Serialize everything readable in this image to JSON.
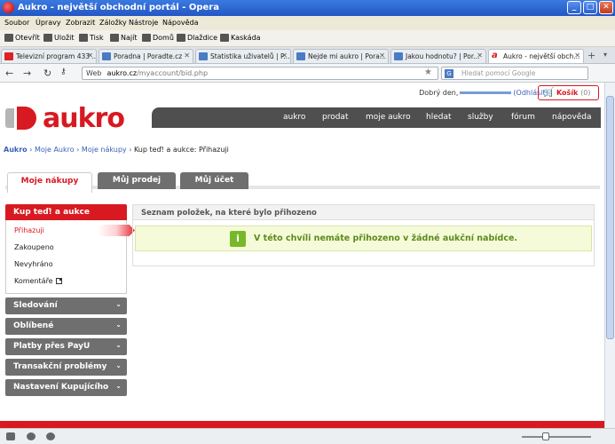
{
  "window": {
    "title": "Aukro - největší obchodní portál - Opera"
  },
  "menu": [
    "Soubor",
    "Úpravy",
    "Zobrazit",
    "Záložky",
    "Nástroje",
    "Nápověda"
  ],
  "toolbar": [
    "Otevřít",
    "Uložit",
    "Tisk",
    "Najít",
    "Domů",
    "Dlaždice",
    "Kaskáda"
  ],
  "tabs": [
    {
      "label": "Televizní program 433 ..."
    },
    {
      "label": "Poradna | Poradte.cz"
    },
    {
      "label": "Statistika uživatelů | P..."
    },
    {
      "label": "Nejde mi aukro | Pora..."
    },
    {
      "label": "Jakou hodnotu? | Por..."
    },
    {
      "label": "Aukro - největší obch..."
    }
  ],
  "address": {
    "badge": "Web",
    "host": "aukro.cz",
    "path": "/myaccount/bid.php",
    "search_placeholder": "Hledat pomocí Google"
  },
  "header": {
    "greeting": "Dobrý den,",
    "logout": "(Odhlásit)",
    "separator": "|",
    "cart_label": "Košík",
    "cart_count": "(0)",
    "logo_text": "aukro"
  },
  "nav": [
    "aukro",
    "prodat",
    "moje aukro",
    "hledat",
    "služby",
    "fórum",
    "nápověda"
  ],
  "breadcrumb": {
    "items": [
      "Aukro",
      "Moje Aukro",
      "Moje nákupy"
    ],
    "sep": "›",
    "current": "Kup teď! a aukce: Přihazuji"
  },
  "page_tabs": [
    "Moje nákupy",
    "Můj prodej",
    "Můj účet"
  ],
  "sidebar": {
    "section_title": "Kup teď! a aukce",
    "items": [
      "Přihazuji",
      "Zakoupeno",
      "Nevyhráno",
      "Komentáře"
    ],
    "groups": [
      "Sledování",
      "Oblíbené",
      "Platby přes PayU",
      "Transakční problémy",
      "Nastavení Kupujícího"
    ]
  },
  "panel": {
    "title": "Seznam položek, na které bylo přihozeno",
    "notice": "V této chvíli nemáte přihozeno v žádné aukční nabídce."
  }
}
